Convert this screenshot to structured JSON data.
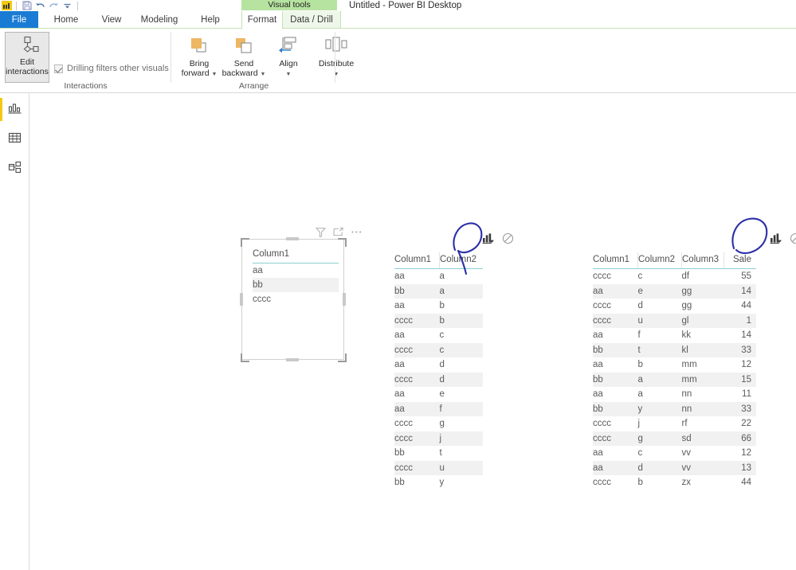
{
  "window": {
    "title": "Untitled - Power BI Desktop",
    "contextual_tab_group": "Visual tools"
  },
  "quick_access": {
    "logo": "power-bi-logo",
    "items": [
      {
        "name": "save-icon",
        "label": "Save"
      },
      {
        "name": "undo-icon",
        "label": "Undo"
      },
      {
        "name": "redo-icon",
        "label": "Redo"
      },
      {
        "name": "customize-quick-access-toolbar-icon",
        "label": "Customize Quick Access Toolbar"
      }
    ]
  },
  "ribbon": {
    "tabs": [
      {
        "id": "file",
        "label": "File",
        "active": false
      },
      {
        "id": "home",
        "label": "Home",
        "active": false
      },
      {
        "id": "view",
        "label": "View",
        "active": false
      },
      {
        "id": "modeling",
        "label": "Modeling",
        "active": false
      },
      {
        "id": "help",
        "label": "Help",
        "active": false
      },
      {
        "id": "format",
        "label": "Format",
        "active": true
      },
      {
        "id": "datadrill",
        "label": "Data / Drill",
        "active": false
      }
    ],
    "groups": [
      {
        "id": "interactions",
        "label": "Interactions",
        "edit_interactions": {
          "label_line1": "Edit",
          "label_line2": "interactions",
          "pressed": true
        },
        "checkbox": {
          "label": "Drilling filters other visuals",
          "checked": true
        }
      },
      {
        "id": "arrange",
        "label": "Arrange",
        "buttons": [
          {
            "id": "bring-forward",
            "line1": "Bring",
            "line2": "forward",
            "has_dropdown": true
          },
          {
            "id": "send-backward",
            "line1": "Send",
            "line2": "backward",
            "has_dropdown": true
          },
          {
            "id": "align",
            "line1": "Align",
            "line2": "",
            "has_dropdown": true
          },
          {
            "id": "distribute",
            "line1": "Distribute",
            "line2": "",
            "has_dropdown": true
          }
        ]
      }
    ]
  },
  "nav_rail": {
    "items": [
      {
        "id": "report-view",
        "label": "Report view",
        "icon": "bar-chart-icon",
        "active": true
      },
      {
        "id": "data-view",
        "label": "Data view",
        "icon": "table-icon",
        "active": false
      },
      {
        "id": "model-view",
        "label": "Model view",
        "icon": "model-icon",
        "active": false
      }
    ]
  },
  "canvas": {
    "visuals": [
      {
        "id": "visual-1",
        "selected": true,
        "header_icons": [
          {
            "name": "filter-icon",
            "title": "Filters"
          },
          {
            "name": "focus-mode-icon",
            "title": "Focus mode"
          },
          {
            "name": "more-options-icon",
            "title": "More options"
          }
        ],
        "columns": [
          "Column1"
        ],
        "rows": [
          [
            "aa"
          ],
          [
            "bb"
          ],
          [
            "cccc"
          ]
        ]
      },
      {
        "id": "visual-2",
        "selected": false,
        "interaction_icons": [
          {
            "name": "filter-interaction-icon",
            "title": "Filter",
            "selected": true,
            "annotated": true
          },
          {
            "name": "none-interaction-icon",
            "title": "None",
            "selected": false,
            "annotated": false
          }
        ],
        "columns": [
          "Column1",
          "Column2"
        ],
        "rows": [
          [
            "aa",
            "a"
          ],
          [
            "bb",
            "a"
          ],
          [
            "aa",
            "b"
          ],
          [
            "cccc",
            "b"
          ],
          [
            "aa",
            "c"
          ],
          [
            "cccc",
            "c"
          ],
          [
            "aa",
            "d"
          ],
          [
            "cccc",
            "d"
          ],
          [
            "aa",
            "e"
          ],
          [
            "aa",
            "f"
          ],
          [
            "cccc",
            "g"
          ],
          [
            "cccc",
            "j"
          ],
          [
            "bb",
            "t"
          ],
          [
            "cccc",
            "u"
          ],
          [
            "bb",
            "y"
          ]
        ]
      },
      {
        "id": "visual-3",
        "selected": false,
        "interaction_icons": [
          {
            "name": "filter-interaction-icon",
            "title": "Filter",
            "selected": true,
            "annotated": true
          },
          {
            "name": "none-interaction-icon",
            "title": "None",
            "selected": false,
            "annotated": false
          }
        ],
        "columns": [
          "Column1",
          "Column2",
          "Column3",
          "Sale"
        ],
        "numeric_columns": [
          3
        ],
        "rows": [
          [
            "cccc",
            "c",
            "df",
            "55"
          ],
          [
            "aa",
            "e",
            "gg",
            "14"
          ],
          [
            "cccc",
            "d",
            "gg",
            "44"
          ],
          [
            "cccc",
            "u",
            "gl",
            "1"
          ],
          [
            "aa",
            "f",
            "kk",
            "14"
          ],
          [
            "bb",
            "t",
            "kl",
            "33"
          ],
          [
            "aa",
            "b",
            "mm",
            "12"
          ],
          [
            "bb",
            "a",
            "mm",
            "15"
          ],
          [
            "aa",
            "a",
            "nn",
            "11"
          ],
          [
            "bb",
            "y",
            "nn",
            "33"
          ],
          [
            "cccc",
            "j",
            "rf",
            "22"
          ],
          [
            "cccc",
            "g",
            "sd",
            "66"
          ],
          [
            "aa",
            "c",
            "vv",
            "12"
          ],
          [
            "aa",
            "d",
            "vv",
            "13"
          ],
          [
            "cccc",
            "b",
            "zx",
            "44"
          ]
        ]
      }
    ]
  },
  "annotations": [
    {
      "id": "annotation-1",
      "color": "#2a2fa8",
      "target": "visual-2 filter-interaction-icon",
      "shape": "hand-drawn-circle"
    },
    {
      "id": "annotation-2",
      "color": "#2a2fa8",
      "target": "visual-3 filter-interaction-icon",
      "shape": "hand-drawn-circle"
    }
  ],
  "colors": {
    "file_tab": "#1a7bd4",
    "contextual_banner": "#b7e3a0",
    "accent_yellow": "#f2c811",
    "header_underline": "#8ccfd4",
    "row_alt": "#f1f1f1",
    "annotation_blue": "#2a2fa8"
  }
}
